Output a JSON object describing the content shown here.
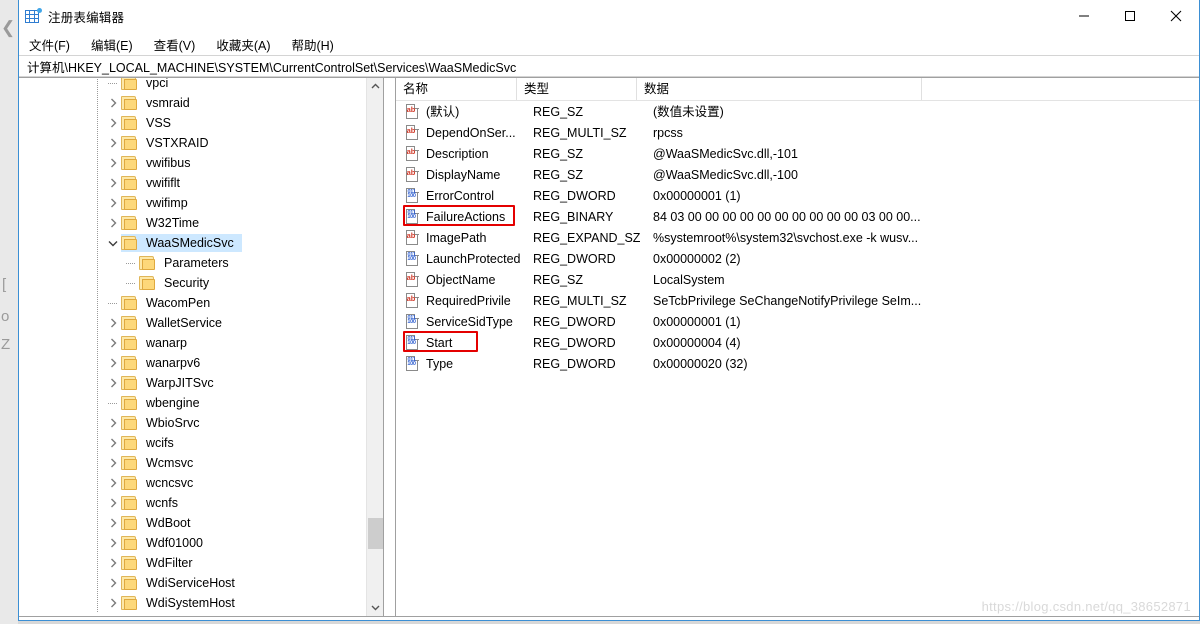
{
  "window": {
    "title": "注册表编辑器",
    "icon": "registry-editor-icon",
    "controls": {
      "minimize": "最小化",
      "maximize": "最大化",
      "close": "关闭"
    }
  },
  "menu": {
    "items": [
      {
        "label": "文件(F)",
        "name": "menu-file"
      },
      {
        "label": "编辑(E)",
        "name": "menu-edit"
      },
      {
        "label": "查看(V)",
        "name": "menu-view"
      },
      {
        "label": "收藏夹(A)",
        "name": "menu-favorites"
      },
      {
        "label": "帮助(H)",
        "name": "menu-help"
      }
    ]
  },
  "address": {
    "path": "计算机\\HKEY_LOCAL_MACHINE\\SYSTEM\\CurrentControlSet\\Services\\WaaSMedicSvc"
  },
  "tree": {
    "selected": "WaaSMedicSvc",
    "items": [
      {
        "label": "vpci",
        "depth": 0,
        "expander": "none",
        "selected": false
      },
      {
        "label": "vsmraid",
        "depth": 0,
        "expander": "collapsed",
        "selected": false
      },
      {
        "label": "VSS",
        "depth": 0,
        "expander": "collapsed",
        "selected": false
      },
      {
        "label": "VSTXRAID",
        "depth": 0,
        "expander": "collapsed",
        "selected": false
      },
      {
        "label": "vwifibus",
        "depth": 0,
        "expander": "collapsed",
        "selected": false
      },
      {
        "label": "vwififlt",
        "depth": 0,
        "expander": "collapsed",
        "selected": false
      },
      {
        "label": "vwifimp",
        "depth": 0,
        "expander": "collapsed",
        "selected": false
      },
      {
        "label": "W32Time",
        "depth": 0,
        "expander": "collapsed",
        "selected": false
      },
      {
        "label": "WaaSMedicSvc",
        "depth": 0,
        "expander": "expanded",
        "selected": true
      },
      {
        "label": "Parameters",
        "depth": 1,
        "expander": "none",
        "selected": false
      },
      {
        "label": "Security",
        "depth": 1,
        "expander": "none",
        "selected": false
      },
      {
        "label": "WacomPen",
        "depth": 0,
        "expander": "none",
        "selected": false
      },
      {
        "label": "WalletService",
        "depth": 0,
        "expander": "collapsed",
        "selected": false
      },
      {
        "label": "wanarp",
        "depth": 0,
        "expander": "collapsed",
        "selected": false
      },
      {
        "label": "wanarpv6",
        "depth": 0,
        "expander": "collapsed",
        "selected": false
      },
      {
        "label": "WarpJITSvc",
        "depth": 0,
        "expander": "collapsed",
        "selected": false
      },
      {
        "label": "wbengine",
        "depth": 0,
        "expander": "none",
        "selected": false
      },
      {
        "label": "WbioSrvc",
        "depth": 0,
        "expander": "collapsed",
        "selected": false
      },
      {
        "label": "wcifs",
        "depth": 0,
        "expander": "collapsed",
        "selected": false
      },
      {
        "label": "Wcmsvc",
        "depth": 0,
        "expander": "collapsed",
        "selected": false
      },
      {
        "label": "wcncsvc",
        "depth": 0,
        "expander": "collapsed",
        "selected": false
      },
      {
        "label": "wcnfs",
        "depth": 0,
        "expander": "collapsed",
        "selected": false
      },
      {
        "label": "WdBoot",
        "depth": 0,
        "expander": "collapsed",
        "selected": false
      },
      {
        "label": "Wdf01000",
        "depth": 0,
        "expander": "collapsed",
        "selected": false
      },
      {
        "label": "WdFilter",
        "depth": 0,
        "expander": "collapsed",
        "selected": false
      },
      {
        "label": "WdiServiceHost",
        "depth": 0,
        "expander": "collapsed",
        "selected": false
      },
      {
        "label": "WdiSystemHost",
        "depth": 0,
        "expander": "collapsed",
        "selected": false
      }
    ]
  },
  "values": {
    "columns": [
      {
        "label": "名称",
        "name": "column-name"
      },
      {
        "label": "类型",
        "name": "column-type"
      },
      {
        "label": "数据",
        "name": "column-data"
      }
    ],
    "rows": [
      {
        "name": "(默认)",
        "type": "REG_SZ",
        "data": "(数值未设置)",
        "icon": "string-value-icon",
        "highlighted": false
      },
      {
        "name": "DependOnSer...",
        "type": "REG_MULTI_SZ",
        "data": "rpcss",
        "icon": "string-value-icon",
        "highlighted": false
      },
      {
        "name": "Description",
        "type": "REG_SZ",
        "data": "@WaaSMedicSvc.dll,-101",
        "icon": "string-value-icon",
        "highlighted": false
      },
      {
        "name": "DisplayName",
        "type": "REG_SZ",
        "data": "@WaaSMedicSvc.dll,-100",
        "icon": "string-value-icon",
        "highlighted": false
      },
      {
        "name": "ErrorControl",
        "type": "REG_DWORD",
        "data": "0x00000001 (1)",
        "icon": "dword-value-icon",
        "highlighted": false
      },
      {
        "name": "FailureActions",
        "type": "REG_BINARY",
        "data": "84 03 00 00 00 00 00 00 00 00 00 00 03 00 00...",
        "icon": "dword-value-icon",
        "highlighted": true
      },
      {
        "name": "ImagePath",
        "type": "REG_EXPAND_SZ",
        "data": "%systemroot%\\system32\\svchost.exe -k wusv...",
        "icon": "string-value-icon",
        "highlighted": false
      },
      {
        "name": "LaunchProtected",
        "type": "REG_DWORD",
        "data": "0x00000002 (2)",
        "icon": "dword-value-icon",
        "highlighted": false
      },
      {
        "name": "ObjectName",
        "type": "REG_SZ",
        "data": "LocalSystem",
        "icon": "string-value-icon",
        "highlighted": false
      },
      {
        "name": "RequiredPrivile",
        "type": "REG_MULTI_SZ",
        "data": "SeTcbPrivilege SeChangeNotifyPrivilege SeIm...",
        "icon": "string-value-icon",
        "highlighted": false
      },
      {
        "name": "ServiceSidType",
        "type": "REG_DWORD",
        "data": "0x00000001 (1)",
        "icon": "dword-value-icon",
        "highlighted": false
      },
      {
        "name": "Start",
        "type": "REG_DWORD",
        "data": "0x00000004 (4)",
        "icon": "dword-value-icon",
        "highlighted": true
      },
      {
        "name": "Type",
        "type": "REG_DWORD",
        "data": "0x00000020 (32)",
        "icon": "dword-value-icon",
        "highlighted": false
      }
    ]
  },
  "annotations": {
    "color": "#e40000",
    "boxes": [
      {
        "target": "FailureActions"
      },
      {
        "target": "Start"
      }
    ]
  },
  "watermark": {
    "text": "https://blog.csdn.net/qq_38652871"
  }
}
